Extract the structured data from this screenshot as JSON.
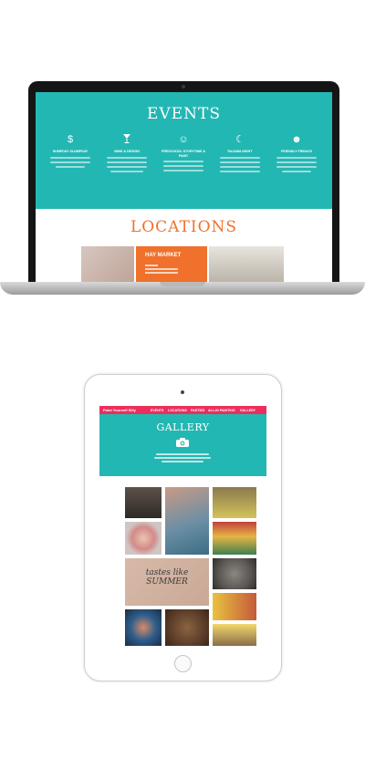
{
  "laptop": {
    "events_title": "EVENTS",
    "events": [
      {
        "icon": "dollar-icon",
        "glyph": "$",
        "title": "HUMPDAY SLUMPDAY"
      },
      {
        "icon": "cocktail-icon",
        "glyph": "🍸",
        "title": "WINE & DESIGN"
      },
      {
        "icon": "smiley-icon",
        "glyph": "☺",
        "title": "PRESCHOOL STORYTIME & PAINT"
      },
      {
        "icon": "moon-icon",
        "glyph": "☾",
        "title": "PAJAMA NIGHT"
      },
      {
        "icon": "friends-icon",
        "glyph": "☻",
        "title": "FRIENDLY FRIDAYS"
      }
    ],
    "locations_title": "LOCATIONS",
    "location_card_title": "HAY MARKET"
  },
  "tablet": {
    "logo": "Paint Yourself Silly",
    "nav_items": [
      "EVENTS",
      "LOCATIONS",
      "PARTIES",
      "ALL-IN PAINTING",
      "GALLERY"
    ],
    "gallery_title": "GALLERY",
    "photo_text": "tastes like SUMMER"
  },
  "colors": {
    "teal": "#23b7b3",
    "orange": "#f0712b",
    "pink": "#ec2e5d"
  }
}
